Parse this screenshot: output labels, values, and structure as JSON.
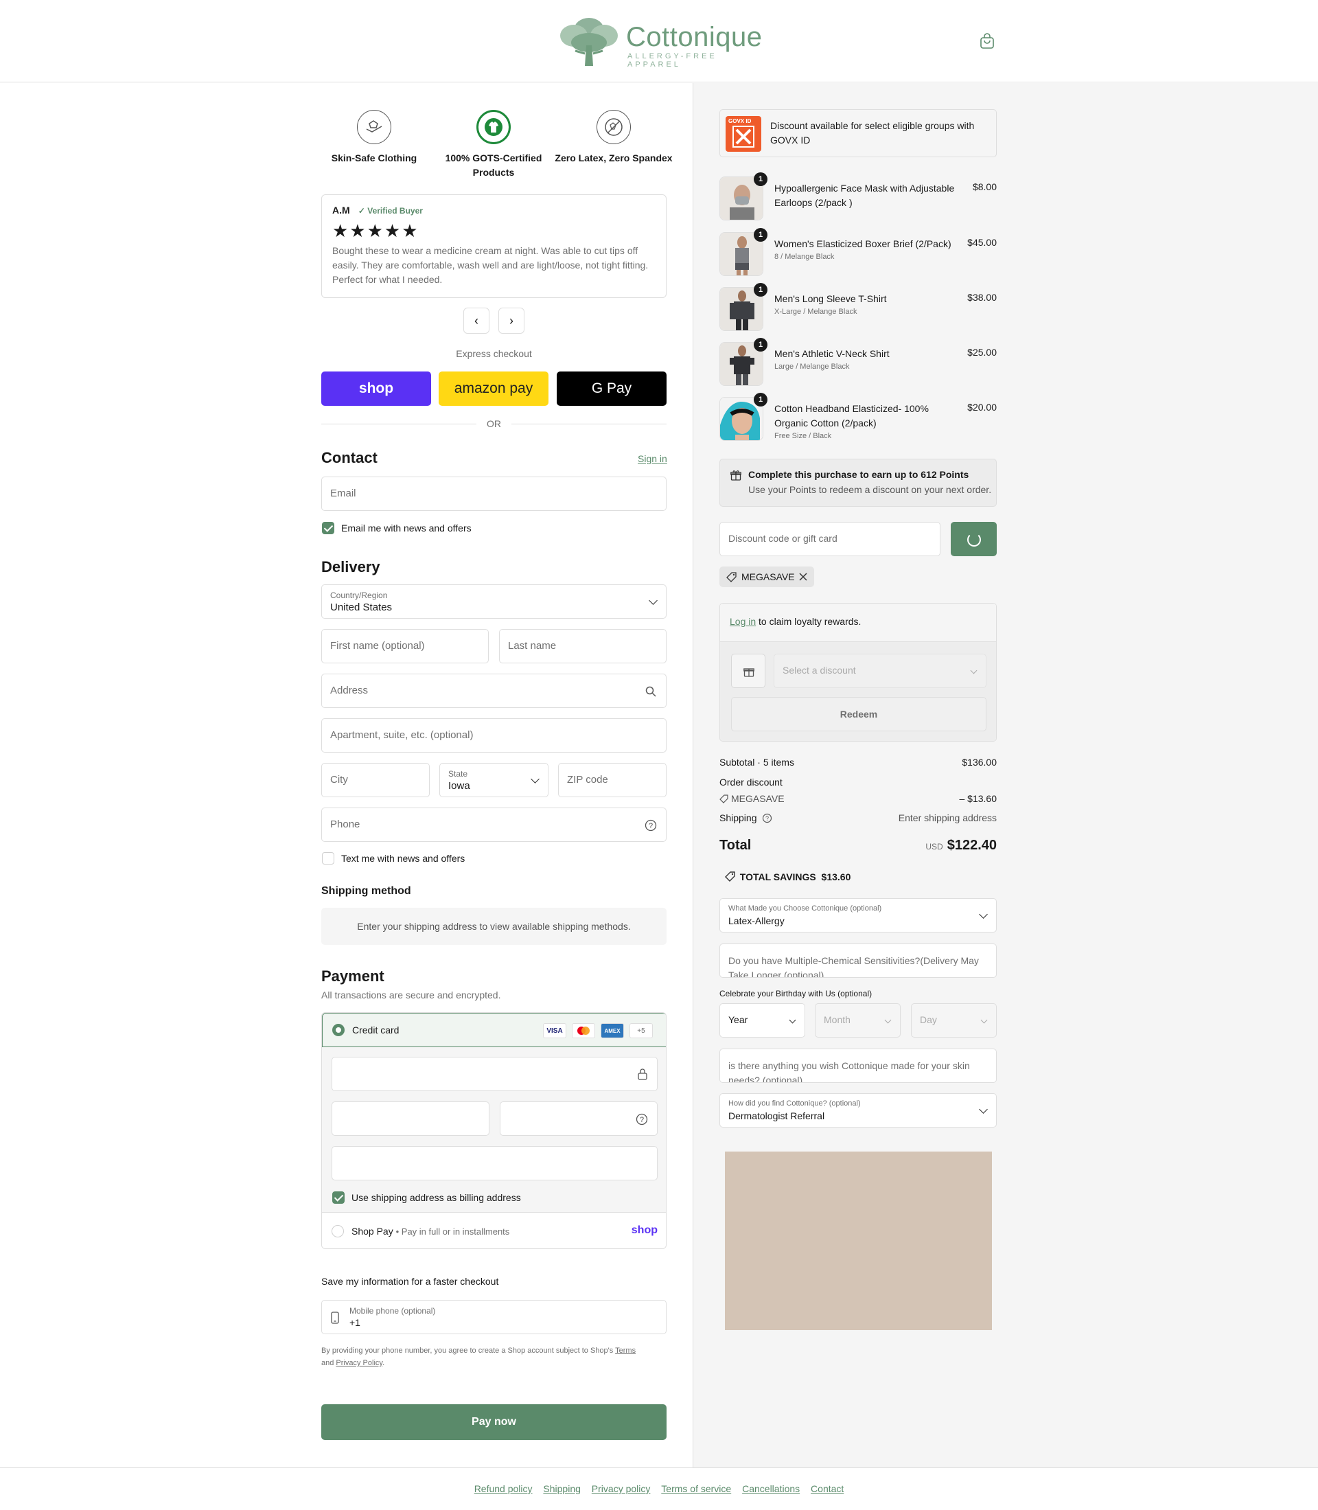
{
  "header": {
    "brand": "Cottonique",
    "tagline": "ALLERGY-FREE APPAREL",
    "cart_icon": "shopping-bag-icon"
  },
  "badges": [
    {
      "label": "Skin-Safe Clothing",
      "icon": "hands-shirt-icon"
    },
    {
      "label": "100% GOTS-Certified Products",
      "icon": "gots-certified-icon"
    },
    {
      "label": "Zero Latex, Zero Spandex",
      "icon": "no-latex-icon"
    }
  ],
  "review": {
    "author": "A.M",
    "verified": "✓ Verified Buyer",
    "stars": "★★★★★",
    "rating": 5,
    "text": "Bought these to wear a medicine cream at night. Was able to cut tips off easily. They are comfortable, wash well and are light/loose, not tight fitting. Perfect for what I needed."
  },
  "express": {
    "label": "Express checkout",
    "shop": "shop",
    "amazon": "amazon pay",
    "gpay": "G Pay",
    "or": "OR"
  },
  "contact": {
    "title": "Contact",
    "sign_in": "Sign in",
    "email_placeholder": "Email",
    "email_news": "Email me with news and offers",
    "email_news_checked": true
  },
  "delivery": {
    "title": "Delivery",
    "country_label": "Country/Region",
    "country_value": "United States",
    "first_name": "First name (optional)",
    "last_name": "Last name",
    "address": "Address",
    "apartment": "Apartment, suite, etc. (optional)",
    "city": "City",
    "state_label": "State",
    "state_value": "Iowa",
    "zip": "ZIP code",
    "phone": "Phone",
    "text_news": "Text me with news and offers",
    "text_news_checked": false
  },
  "shipping_method": {
    "title": "Shipping method",
    "info": "Enter your shipping address to view available shipping methods."
  },
  "payment": {
    "title": "Payment",
    "subtitle": "All transactions are secure and encrypted.",
    "credit_card": "Credit card",
    "cards": [
      "VISA",
      "MC",
      "AMEX",
      "+5"
    ],
    "billing_same": "Use shipping address as billing address",
    "billing_same_checked": true,
    "shop_pay": "Shop Pay",
    "shop_pay_note": "Pay in full or in installments",
    "shop_logo": "shop"
  },
  "save_info": {
    "title": "Save my information for a faster checkout",
    "phone_label": "Mobile phone (optional)",
    "phone_value": "+1",
    "legal_1": "By providing your phone number, you agree to create a Shop account subject to Shop's ",
    "terms": "Terms",
    "legal_and": "and ",
    "privacy": "Privacy Policy",
    "legal_end": "."
  },
  "pay_now": "Pay now",
  "govx": {
    "text": "Discount available for select eligible groups with GOVX ID",
    "logo_text": "GOVX ID"
  },
  "items": [
    {
      "qty": "1",
      "name": "Hypoallergenic Face Mask with Adjustable Earloops (2/pack )",
      "variant": "",
      "price": "$8.00"
    },
    {
      "qty": "1",
      "name": "Women's Elasticized Boxer Brief (2/Pack)",
      "variant": "8 / Melange Black",
      "price": "$45.00"
    },
    {
      "qty": "1",
      "name": "Men's Long Sleeve T-Shirt",
      "variant": "X-Large / Melange Black",
      "price": "$38.00"
    },
    {
      "qty": "1",
      "name": "Men's Athletic V-Neck Shirt",
      "variant": "Large / Melange Black",
      "price": "$25.00"
    },
    {
      "qty": "1",
      "name": "Cotton Headband Elasticized- 100% Organic Cotton (2/pack)",
      "variant": "Free Size / Black",
      "price": "$20.00"
    }
  ],
  "points": {
    "title": "Complete this purchase to earn up to 612 Points",
    "sub": "Use your Points to redeem a discount on your next order."
  },
  "discount": {
    "placeholder": "Discount code or gift card",
    "applied_code": "MEGASAVE"
  },
  "loyalty": {
    "login": "Log in",
    "claim": " to claim loyalty rewards.",
    "select": "Select a discount",
    "redeem": "Redeem"
  },
  "summary": {
    "subtotal_label": "Subtotal · 5 items",
    "subtotal": "$136.00",
    "order_discount": "Order discount",
    "code": "MEGASAVE",
    "code_amount": "– $13.60",
    "shipping_label": "Shipping",
    "shipping_value": "Enter shipping address",
    "total_label": "Total",
    "currency": "USD",
    "total": "$122.40",
    "savings": "TOTAL SAVINGS  $13.60"
  },
  "survey": {
    "choose_label": "What Made you Choose Cottonique (optional)",
    "choose_value": "Latex-Allergy",
    "mcs": "Do you have Multiple-Chemical Sensitivities?(Delivery May Take Longer (optional)",
    "birthday_label": "Celebrate your Birthday with Us (optional)",
    "year": "Year",
    "month": "Month",
    "day": "Day",
    "wish": "is there anything you wish Cottonique made for your skin needs? (optional)",
    "find_label": "How did you find Cottonique? (optional)",
    "find_value": "Dermatologist Referral"
  },
  "footer": [
    "Refund policy",
    "Shipping",
    "Privacy policy",
    "Terms of service",
    "Cancellations",
    "Contact"
  ],
  "colors": {
    "accent": "#5a8a6a",
    "shop_purple": "#5a31f4",
    "amazon_yellow": "#ffd814"
  }
}
